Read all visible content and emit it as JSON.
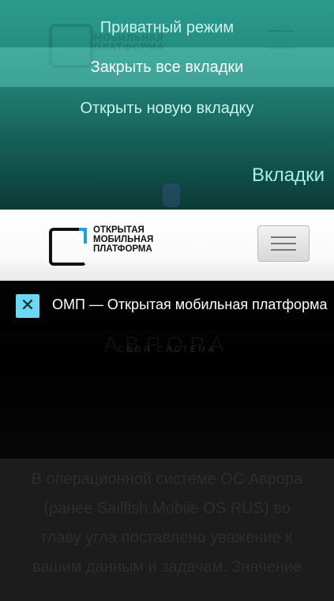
{
  "pulley_menu": {
    "items": [
      {
        "label": "Приватный режим"
      },
      {
        "label": "Закрыть все вкладки"
      },
      {
        "label": "Открыть новую вкладку"
      }
    ],
    "title": "Вкладки"
  },
  "site_header": {
    "logo_lines": [
      "ОТКРЫТАЯ",
      "МОБИЛЬНАЯ",
      "ПЛАТФОРМА"
    ],
    "menu_icon": "hamburger-icon"
  },
  "tab": {
    "close_icon": "close-icon",
    "close_glyph": "✕",
    "title": "ОМП — Открытая мобильная платформа"
  },
  "background_page": {
    "banner_subtitle": "СВОЯ СИСТЕМА",
    "body_text": "В операционной системе ОС Аврора (ранее Sailfish Mobile OS RUS) во главу угла поставлено уважение к вашим данным и задачам. Значение"
  },
  "colors": {
    "accent": "#2a9d8f",
    "close_button": "#6ad8f2",
    "logo_accent": "#1aa0e0"
  }
}
